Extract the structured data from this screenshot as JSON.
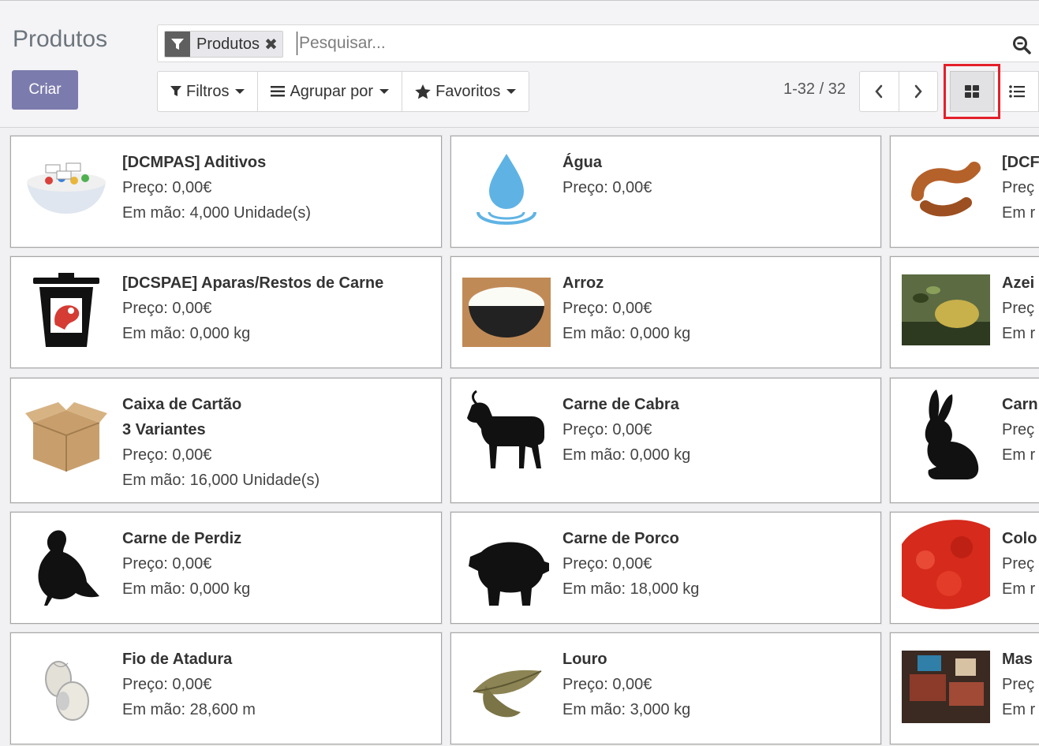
{
  "page": {
    "title": "Produtos",
    "create_label": "Criar"
  },
  "search": {
    "facet_label": "Produtos",
    "facet_remove": "✖",
    "placeholder": "Pesquisar..."
  },
  "filters": {
    "filters_label": "Filtros",
    "group_by_label": "Agrupar por",
    "favorites_label": "Favoritos"
  },
  "pager": {
    "value": "1-32 / 32",
    "prev": "‹",
    "next": "›"
  },
  "views": {
    "active": "kanban",
    "options": [
      "kanban",
      "list"
    ]
  },
  "highlight": {
    "target": "kanban-view-button",
    "color": "#e3202a"
  },
  "colors": {
    "primary": "#7c7bad",
    "water": "#5fb3e4",
    "meat_red": "#d43c34"
  },
  "products": [
    {
      "title": "[DCMPAS] Aditivos",
      "price": "Preço: 0,00€",
      "stock": "Em mão: 4,000 Unidade(s)",
      "icon": "additives-bowl-image"
    },
    {
      "title": "Água",
      "price": "Preço: 0,00€",
      "icon": "water-drop-image"
    },
    {
      "title": "[DCF",
      "price": "Preç",
      "stock": "Em r",
      "icon": "sausage-image"
    },
    {
      "title": "[DCSPAE] Aparas/Restos de Carne",
      "price": "Preço: 0,00€",
      "stock": "Em mão: 0,000 kg",
      "icon": "meat-trash-bin-image"
    },
    {
      "title": "Arroz",
      "price": "Preço: 0,00€",
      "stock": "Em mão: 0,000 kg",
      "icon": "rice-bowl-image"
    },
    {
      "title": "Azei",
      "price": "Preç",
      "stock": "Em r",
      "icon": "olive-oil-image"
    },
    {
      "title": "Caixa de Cartão",
      "variants": "3 Variantes",
      "price": "Preço: 0,00€",
      "stock": "Em mão: 16,000 Unidade(s)",
      "icon": "cardboard-box-image"
    },
    {
      "title": "Carne de Cabra",
      "price": "Preço: 0,00€",
      "stock": "Em mão: 0,000 kg",
      "icon": "goat-image"
    },
    {
      "title": "Carn",
      "price": "Preç",
      "stock": "Em r",
      "icon": "rabbit-image"
    },
    {
      "title": "Carne de Perdiz",
      "price": "Preço: 0,00€",
      "stock": "Em mão: 0,000 kg",
      "icon": "partridge-image"
    },
    {
      "title": "Carne de Porco",
      "price": "Preço: 0,00€",
      "stock": "Em mão: 18,000 kg",
      "icon": "pig-image"
    },
    {
      "title": "Colo",
      "price": "Preç",
      "stock": "Em r",
      "icon": "paprika-image"
    },
    {
      "title": "Fio de Atadura",
      "price": "Preço: 0,00€",
      "stock": "Em mão: 28,600 m",
      "icon": "twine-spool-image"
    },
    {
      "title": "Louro",
      "price": "Preço: 0,00€",
      "stock": "Em mão: 3,000 kg",
      "icon": "bay-leaf-image"
    },
    {
      "title": "Mas",
      "price": "Preç",
      "stock": "Em r",
      "icon": "butchery-image"
    }
  ]
}
